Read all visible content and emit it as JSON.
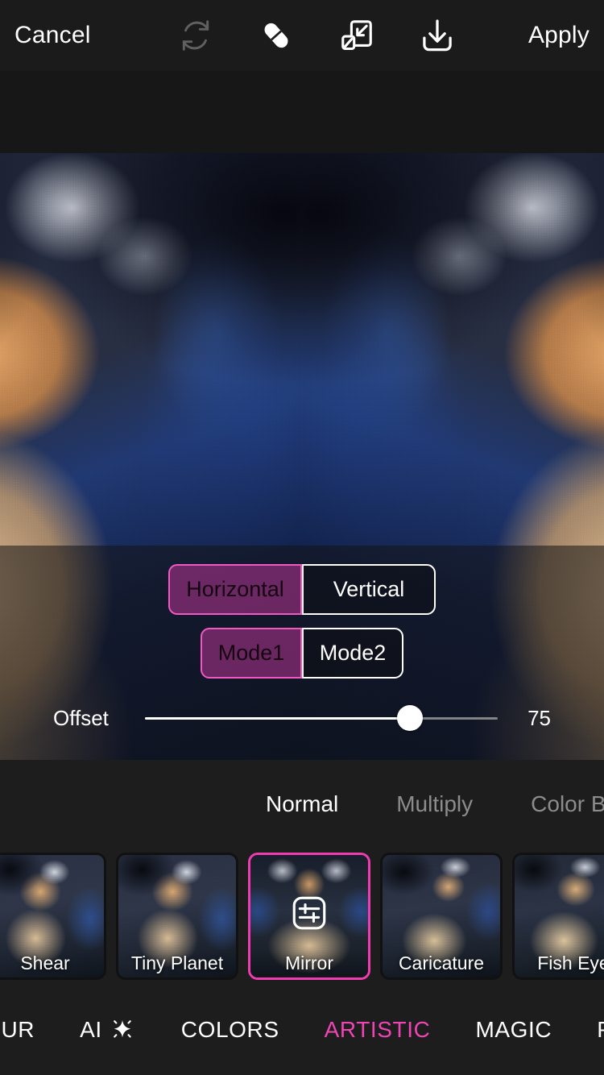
{
  "toolbar": {
    "cancel_label": "Cancel",
    "apply_label": "Apply",
    "icons": [
      {
        "name": "reset-icon",
        "title": "Reset",
        "disabled": true
      },
      {
        "name": "eraser-icon",
        "title": "Eraser",
        "disabled": false
      },
      {
        "name": "resize-icon",
        "title": "Resize",
        "disabled": false
      },
      {
        "name": "download-icon",
        "title": "Save",
        "disabled": false
      }
    ]
  },
  "editor": {
    "effect_name": "Mirror",
    "orientation": {
      "options": [
        "Horizontal",
        "Vertical"
      ],
      "selected": "Horizontal"
    },
    "mode": {
      "options": [
        "Mode1",
        "Mode2"
      ],
      "selected": "Mode1"
    },
    "offset": {
      "label": "Offset",
      "value": "75",
      "percent": 75,
      "min": 0,
      "max": 100
    }
  },
  "blend_modes": {
    "items": [
      "Normal",
      "Multiply",
      "Color Bu"
    ],
    "selected": "Normal"
  },
  "effects": {
    "items": [
      {
        "label": "Shear",
        "selected": false,
        "style": "shear"
      },
      {
        "label": "Tiny Planet",
        "selected": false,
        "style": "tiny-planet"
      },
      {
        "label": "Mirror",
        "selected": true,
        "style": "mirror-th",
        "overlay_icon": "sliders-icon"
      },
      {
        "label": "Caricature",
        "selected": false,
        "style": "caricature"
      },
      {
        "label": "Fish Eye",
        "selected": false,
        "style": "fisheye"
      }
    ]
  },
  "categories": {
    "items": [
      {
        "label": "BLUR",
        "active": false,
        "icon": null
      },
      {
        "label": "AI",
        "active": false,
        "icon": "sparkle-icon"
      },
      {
        "label": "COLORS",
        "active": false,
        "icon": null
      },
      {
        "label": "ARTISTIC",
        "active": true,
        "icon": null
      },
      {
        "label": "MAGIC",
        "active": false,
        "icon": null
      },
      {
        "label": "PAPER",
        "active": false,
        "icon": null
      }
    ],
    "selected": "ARTISTIC"
  },
  "colors": {
    "accent_pink": "#ef45b4",
    "selection_border": "#f03cb0",
    "panel_bg": "#1d1d1d",
    "toolbar_bg": "#1b1b1b",
    "text_primary": "#ffffff",
    "text_muted": "#8c8c8c"
  }
}
